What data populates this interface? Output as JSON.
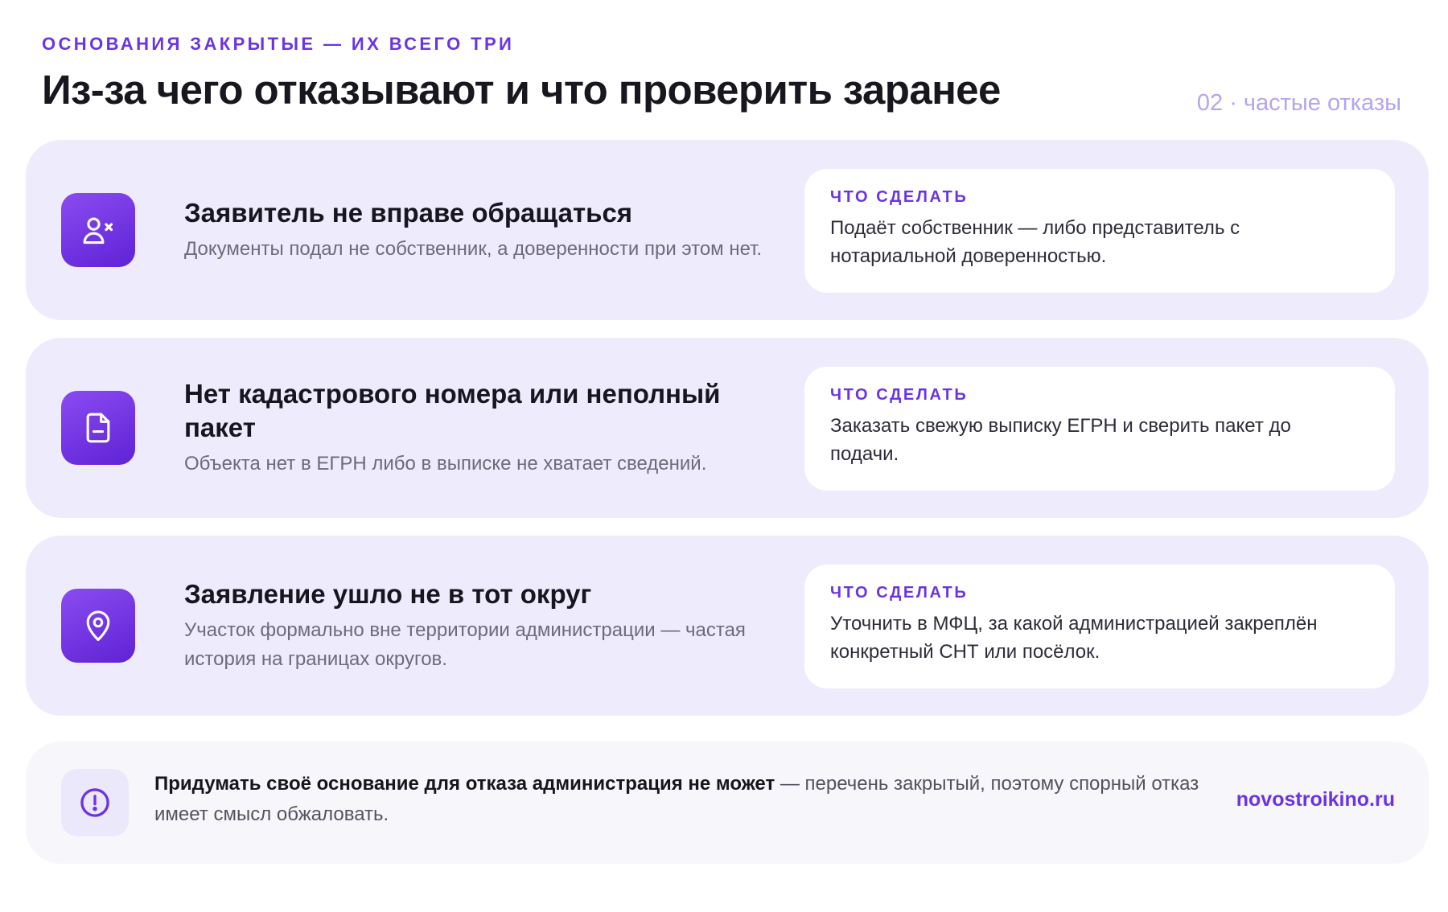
{
  "header": {
    "eyebrow": "ОСНОВАНИЯ ЗАКРЫТЫЕ — ИХ ВСЕГО ТРИ",
    "title": "Из-за чего отказывают и что проверить заранее",
    "tag": "02 · частые отказы"
  },
  "reasons": [
    {
      "icon": "user-x-icon",
      "title": "Заявитель не вправе обращаться",
      "description": "Документы подал не собственник, а доверенности при этом нет.",
      "action_label": "ЧТО СДЕЛАТЬ",
      "action_text": "Подаёт собственник — либо представитель с нотариальной доверенностью."
    },
    {
      "icon": "document-minus-icon",
      "title": "Нет кадастрового номера или неполный пакет",
      "description": "Объекта нет в ЕГРН либо в выписке не хватает сведений.",
      "action_label": "ЧТО СДЕЛАТЬ",
      "action_text": "Заказать свежую выписку ЕГРН и сверить пакет до подачи."
    },
    {
      "icon": "map-pin-icon",
      "title": "Заявление ушло не в тот округ",
      "description": "Участок формально вне территории администрации — частая история на границах округов.",
      "action_label": "ЧТО СДЕЛАТЬ",
      "action_text": "Уточнить в МФЦ, за какой администрацией закреплён конкретный СНТ или посёлок."
    }
  ],
  "note": {
    "icon": "alert-circle-icon",
    "bold": "Придумать своё основание для отказа администрация не может",
    "rest": " — перечень закрытый, поэтому спорный отказ имеет смысл обжаловать.",
    "brand": "novostroikino.ru"
  },
  "colors": {
    "accent": "#6a34e6",
    "card_bg": "#eeebfd",
    "note_bg": "#f7f6fb",
    "tag": "#b4a5ef"
  }
}
